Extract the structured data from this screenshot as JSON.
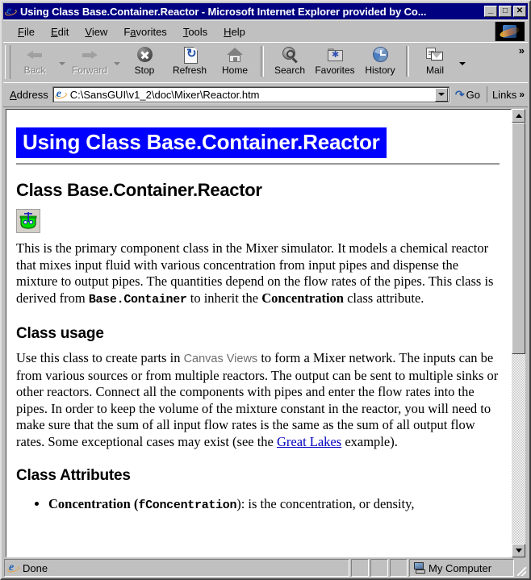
{
  "window": {
    "title": "Using Class Base.Container.Reactor - Microsoft Internet Explorer provided by Co...",
    "app_icon": "ie-logo-icon",
    "controls": {
      "minimize": "_",
      "maximize": "□",
      "close": "✕"
    }
  },
  "menubar": {
    "items": [
      {
        "name": "file",
        "label": "File",
        "accel": "F"
      },
      {
        "name": "edit",
        "label": "Edit",
        "accel": "E"
      },
      {
        "name": "view",
        "label": "View",
        "accel": "V"
      },
      {
        "name": "favorites",
        "label": "Favorites",
        "accel": "a"
      },
      {
        "name": "tools",
        "label": "Tools",
        "accel": "T"
      },
      {
        "name": "help",
        "label": "Help",
        "accel": "H"
      }
    ]
  },
  "toolbar": {
    "buttons": [
      {
        "name": "back",
        "label": "Back",
        "icon": "arrow-left-icon",
        "disabled": true,
        "dropdown": true
      },
      {
        "name": "forward",
        "label": "Forward",
        "icon": "arrow-right-icon",
        "disabled": true,
        "dropdown": true
      },
      {
        "name": "stop",
        "label": "Stop",
        "icon": "stop-icon",
        "disabled": false,
        "dropdown": false
      },
      {
        "name": "refresh",
        "label": "Refresh",
        "icon": "refresh-icon",
        "disabled": false,
        "dropdown": false
      },
      {
        "name": "home",
        "label": "Home",
        "icon": "home-icon",
        "disabled": false,
        "dropdown": false
      },
      {
        "name": "search",
        "label": "Search",
        "icon": "search-icon",
        "disabled": false,
        "dropdown": false
      },
      {
        "name": "favorites",
        "label": "Favorites",
        "icon": "favorites-folder-icon",
        "disabled": false,
        "dropdown": false
      },
      {
        "name": "history",
        "label": "History",
        "icon": "history-clock-icon",
        "disabled": false,
        "dropdown": false
      },
      {
        "name": "mail",
        "label": "Mail",
        "icon": "mail-icon",
        "disabled": false,
        "dropdown": true
      }
    ],
    "overflow_chevron": "»"
  },
  "addressbar": {
    "label": "Address",
    "accel": "A",
    "value": "C:\\SansGUI\\v1_2\\doc\\Mixer\\Reactor.htm",
    "placeholder": "",
    "icon": "ie-document-icon",
    "dropdown_icon": "chevron-down-icon",
    "go_label": "Go",
    "go_icon": "go-arrow-icon",
    "links_label": "Links",
    "links_chevron": "»"
  },
  "document": {
    "banner_title": "Using Class Base.Container.Reactor",
    "heading_class": "Class Base.Container.Reactor",
    "class_icon": "reactor-vessel-icon",
    "intro": {
      "part1": "This is the primary component class in the Mixer simulator. It models a chemical reactor that mixes input fluid with various concentration from input pipes and dispense the mixture to output pipes. The quantities depend on the flow rates of the pipes. This class is derived from ",
      "code1": "Base.Container",
      "part2": " to inherit the ",
      "bold1": "Concentration",
      "part3": " class attribute."
    },
    "usage_heading": "Class usage",
    "usage": {
      "part1": "Use this class to create parts in ",
      "sans1": "Canvas Views",
      "part2": " to form a Mixer network. The inputs can be from various sources or from multiple reactors. The output can be sent to multiple sinks or other reactors. Connect all the components with pipes and enter the flow rates into the pipes. In order to keep the volume of the mixture constant in the reactor, you will need to make sure that the sum of all input flow rates is the same as the sum of all output flow rates. Some exceptional cases may exist (see the ",
      "link_text": "Great Lakes",
      "part3": " example)."
    },
    "attributes_heading": "Class Attributes",
    "attributes": [
      {
        "bold_name": "Concentration",
        "code_name": "fConcentration",
        "description": "): is the concentration, or density,"
      }
    ],
    "banner_color": "#0000FF",
    "link_color": "#0000C0"
  },
  "scrollbar": {
    "up_icon": "triangle-up-icon",
    "down_icon": "triangle-down-icon",
    "thumb_percent": 55
  },
  "statusbar": {
    "status_text": "Done",
    "status_icon": "ie-document-icon",
    "zone_text": "My Computer",
    "zone_icon": "my-computer-icon"
  }
}
